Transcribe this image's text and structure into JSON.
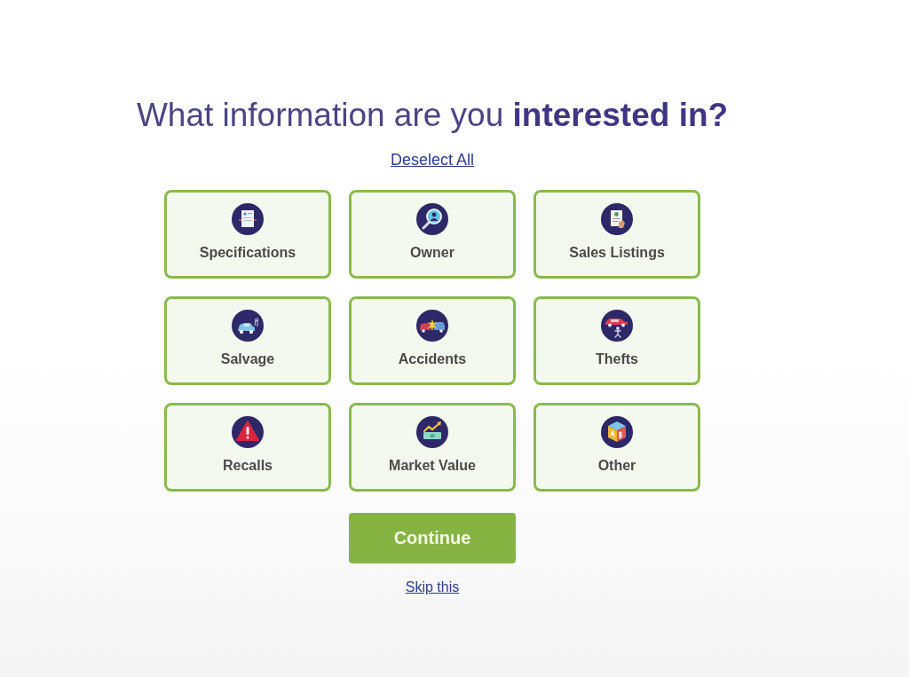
{
  "heading": "What information are you **interested in?**",
  "deselect_all_link": "Deselect All",
  "options": [
    {
      "label": "Specifications",
      "kind": "document",
      "selected": true
    },
    {
      "label": "Owner",
      "kind": "search",
      "selected": true
    },
    {
      "label": "Sales Listings",
      "kind": "listing",
      "selected": true
    },
    {
      "label": "Salvage",
      "kind": "salvage",
      "selected": true
    },
    {
      "label": "Accidents",
      "kind": "crash",
      "selected": true
    },
    {
      "label": "Thefts",
      "kind": "theft",
      "selected": true
    },
    {
      "label": "Recalls",
      "kind": "warning",
      "selected": true
    },
    {
      "label": "Market Value",
      "kind": "value",
      "selected": true
    },
    {
      "label": "Other",
      "kind": "blocks",
      "selected": true
    }
  ],
  "continue_button": "Continue",
  "skip_link": "Skip this"
}
